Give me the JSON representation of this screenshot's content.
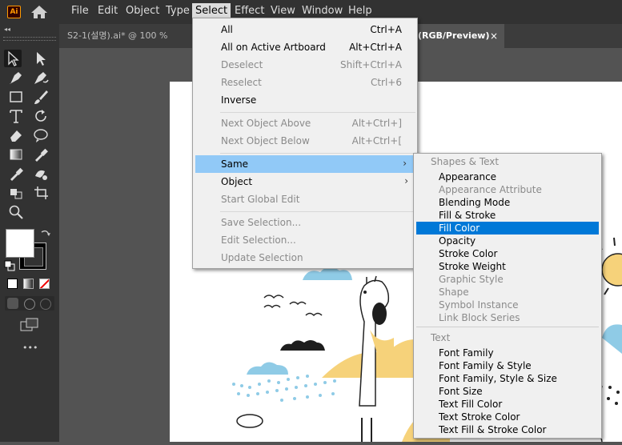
{
  "app": {
    "logo_text": "Ai"
  },
  "menubar": {
    "items": [
      {
        "label": "File"
      },
      {
        "label": "Edit"
      },
      {
        "label": "Object"
      },
      {
        "label": "Type"
      },
      {
        "label": "Select"
      },
      {
        "label": "Effect"
      },
      {
        "label": "View"
      },
      {
        "label": "Window"
      },
      {
        "label": "Help"
      }
    ],
    "active": "Select"
  },
  "tabs": {
    "doc1": "S2-1(설명).ai* @ 100 % (RGB/Pr",
    "doc2": "(RGB/Preview)",
    "close": "×",
    "collapse": "◂◂"
  },
  "toolbar": {
    "icons": [
      "selection-tool",
      "direct-selection-tool",
      "pen-tool",
      "curvature-tool",
      "rectangle-tool",
      "paintbrush-tool",
      "type-tool",
      "rotate-tool",
      "eraser-tool",
      "warp-tool",
      "gradient-tool",
      "blend-tool",
      "eyedropper-tool",
      "shape-builder-tool",
      "live-paint-tool",
      "artboard-tool",
      "zoom-tool"
    ],
    "fill_color": "#ffffff",
    "stroke_color": "#000000",
    "more": "•••"
  },
  "select_menu": {
    "items": [
      {
        "label": "All",
        "shortcut": "Ctrl+A",
        "enabled": true
      },
      {
        "label": "All on Active Artboard",
        "shortcut": "Alt+Ctrl+A",
        "enabled": true
      },
      {
        "label": "Deselect",
        "shortcut": "Shift+Ctrl+A",
        "enabled": false
      },
      {
        "label": "Reselect",
        "shortcut": "Ctrl+6",
        "enabled": false
      },
      {
        "label": "Inverse",
        "shortcut": "",
        "enabled": true
      },
      {
        "label": "Next Object Above",
        "shortcut": "Alt+Ctrl+]",
        "enabled": false
      },
      {
        "label": "Next Object Below",
        "shortcut": "Alt+Ctrl+[",
        "enabled": false
      },
      {
        "label": "Same",
        "shortcut": "",
        "enabled": true,
        "submenu": true
      },
      {
        "label": "Object",
        "shortcut": "",
        "enabled": true,
        "submenu": true
      },
      {
        "label": "Start Global Edit",
        "shortcut": "",
        "enabled": false
      },
      {
        "label": "Save Selection...",
        "shortcut": "",
        "enabled": false
      },
      {
        "label": "Edit Selection...",
        "shortcut": "",
        "enabled": false
      },
      {
        "label": "Update Selection",
        "shortcut": "",
        "enabled": false
      }
    ],
    "submenu_arrow": "›"
  },
  "same_submenu": {
    "header_shapes": "Shapes & Text",
    "shape_items": [
      {
        "label": "Appearance",
        "enabled": true
      },
      {
        "label": "Appearance Attribute",
        "enabled": false
      },
      {
        "label": "Blending Mode",
        "enabled": true
      },
      {
        "label": "Fill & Stroke",
        "enabled": true
      },
      {
        "label": "Fill Color",
        "enabled": true,
        "selected": true
      },
      {
        "label": "Opacity",
        "enabled": true
      },
      {
        "label": "Stroke Color",
        "enabled": true
      },
      {
        "label": "Stroke Weight",
        "enabled": true
      },
      {
        "label": "Graphic Style",
        "enabled": false
      },
      {
        "label": "Shape",
        "enabled": false
      },
      {
        "label": "Symbol Instance",
        "enabled": false
      },
      {
        "label": "Link Block Series",
        "enabled": false
      }
    ],
    "header_text": "Text",
    "text_items": [
      {
        "label": "Font Family",
        "enabled": true
      },
      {
        "label": "Font Family & Style",
        "enabled": true
      },
      {
        "label": "Font Family, Style & Size",
        "enabled": true
      },
      {
        "label": "Font Size",
        "enabled": true
      },
      {
        "label": "Text Fill Color",
        "enabled": true
      },
      {
        "label": "Text Stroke Color",
        "enabled": true
      },
      {
        "label": "Text Fill & Stroke Color",
        "enabled": true
      }
    ]
  },
  "colors": {
    "highlight": "#91c9f7",
    "selected": "#0078d7",
    "accent_yellow": "#f6d27a",
    "accent_blue": "#8fcbe6"
  }
}
